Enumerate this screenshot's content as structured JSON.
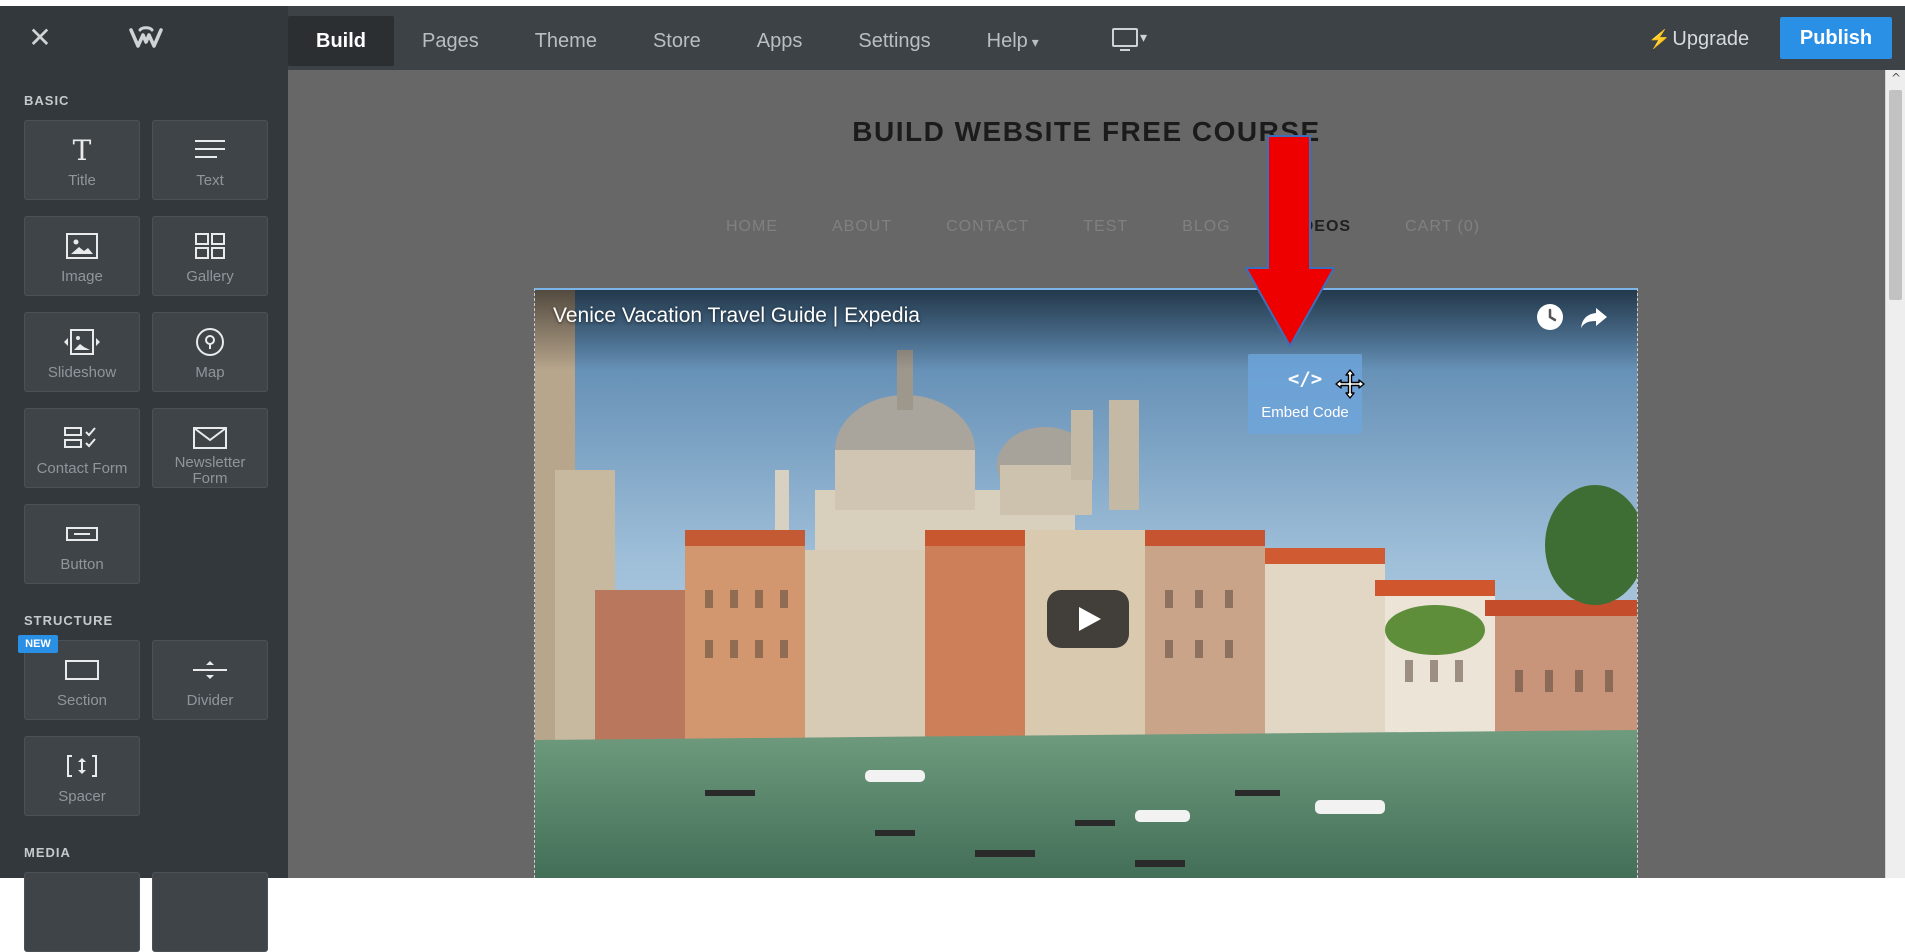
{
  "topbar": {
    "close_icon": "close-icon",
    "logo_icon": "weebly-logo-icon",
    "tabs": [
      {
        "label": "Build",
        "active": true
      },
      {
        "label": "Pages",
        "active": false
      },
      {
        "label": "Theme",
        "active": false
      },
      {
        "label": "Store",
        "active": false
      },
      {
        "label": "Apps",
        "active": false
      },
      {
        "label": "Settings",
        "active": false
      },
      {
        "label": "Help",
        "active": false
      }
    ],
    "help_caret": "▾",
    "device_caret": "▾",
    "upgrade_label": "Upgrade",
    "publish_label": "Publish",
    "accent_color": "#2a90e5"
  },
  "sidebar": {
    "basic_heading": "BASIC",
    "structure_heading": "STRUCTURE",
    "media_heading": "MEDIA",
    "new_badge": "NEW",
    "elements": {
      "title": "Title",
      "text": "Text",
      "image": "Image",
      "gallery": "Gallery",
      "slideshow": "Slideshow",
      "map": "Map",
      "contact_form": "Contact Form",
      "newsletter_line1": "Newsletter",
      "newsletter_line2": "Form",
      "button": "Button",
      "section": "Section",
      "divider": "Divider",
      "spacer": "Spacer"
    }
  },
  "site": {
    "title": "BUILD WEBSITE FREE COURSE",
    "nav": [
      {
        "label": "HOME",
        "active": false
      },
      {
        "label": "ABOUT",
        "active": false
      },
      {
        "label": "CONTACT",
        "active": false
      },
      {
        "label": "TEST",
        "active": false
      },
      {
        "label": "BLOG",
        "active": false
      },
      {
        "label": "VIDEOS",
        "active": true
      },
      {
        "label": "CART (0)",
        "active": false
      }
    ]
  },
  "video": {
    "title": "Venice Vacation Travel Guide | Expedia"
  },
  "embed": {
    "code_glyph": "</>",
    "label": "Embed Code"
  },
  "annotation": {
    "arrow_color": "#ee0000"
  }
}
